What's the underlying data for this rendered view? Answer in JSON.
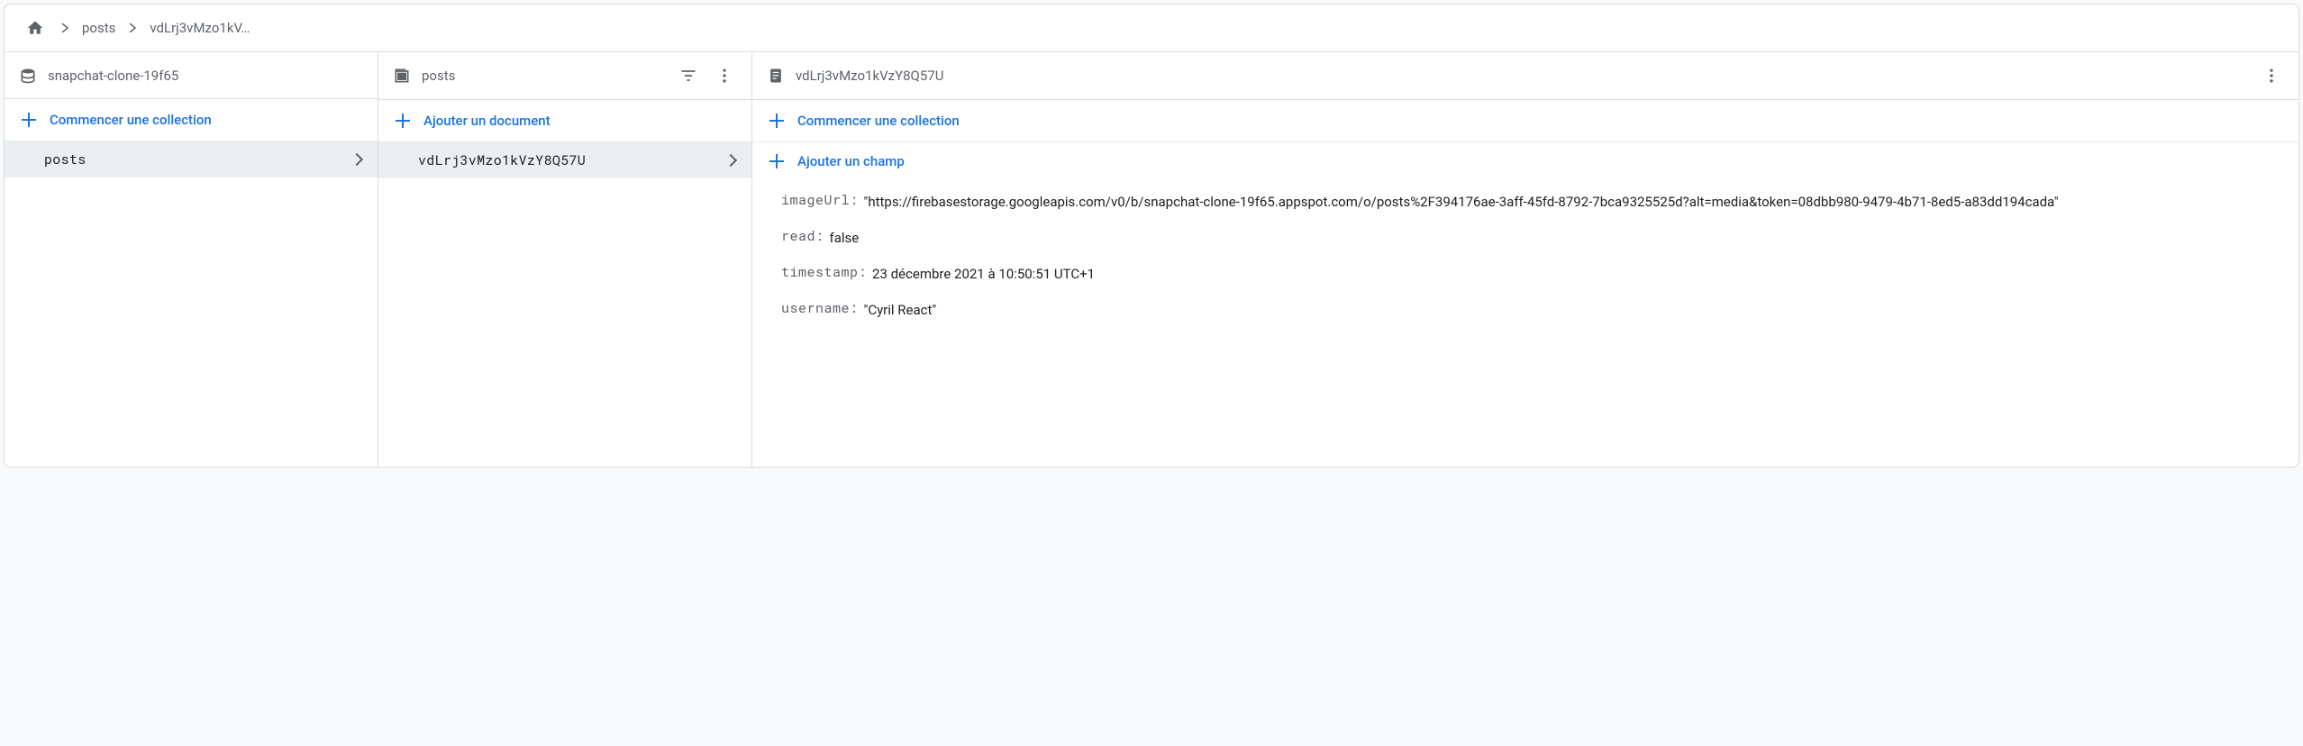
{
  "breadcrumb": {
    "items": [
      "posts",
      "vdLrj3vMzo1kV…"
    ]
  },
  "columns": {
    "project": {
      "title": "snapchat-clone-19f65",
      "action": "Commencer une collection",
      "items": [
        {
          "label": "posts"
        }
      ]
    },
    "collection": {
      "title": "posts",
      "action": "Ajouter un document",
      "items": [
        {
          "label": "vdLrj3vMzo1kVzY8Q57U"
        }
      ]
    },
    "document": {
      "title": "vdLrj3vMzo1kVzY8Q57U",
      "startCollection": "Commencer une collection",
      "addField": "Ajouter un champ",
      "fields": [
        {
          "key": "imageUrl:",
          "value": "\"https://firebasestorage.googleapis.com/v0/b/snapchat-clone-19f65.appspot.com/o/posts%2F394176ae-3aff-45fd-8792-7bca9325525d?alt=media&token=08dbb980-9479-4b71-8ed5-a83dd194cada\""
        },
        {
          "key": "read:",
          "value": "false"
        },
        {
          "key": "timestamp:",
          "value": "23 décembre 2021 à 10:50:51 UTC+1"
        },
        {
          "key": "username:",
          "value": "\"Cyril React\""
        }
      ]
    }
  }
}
